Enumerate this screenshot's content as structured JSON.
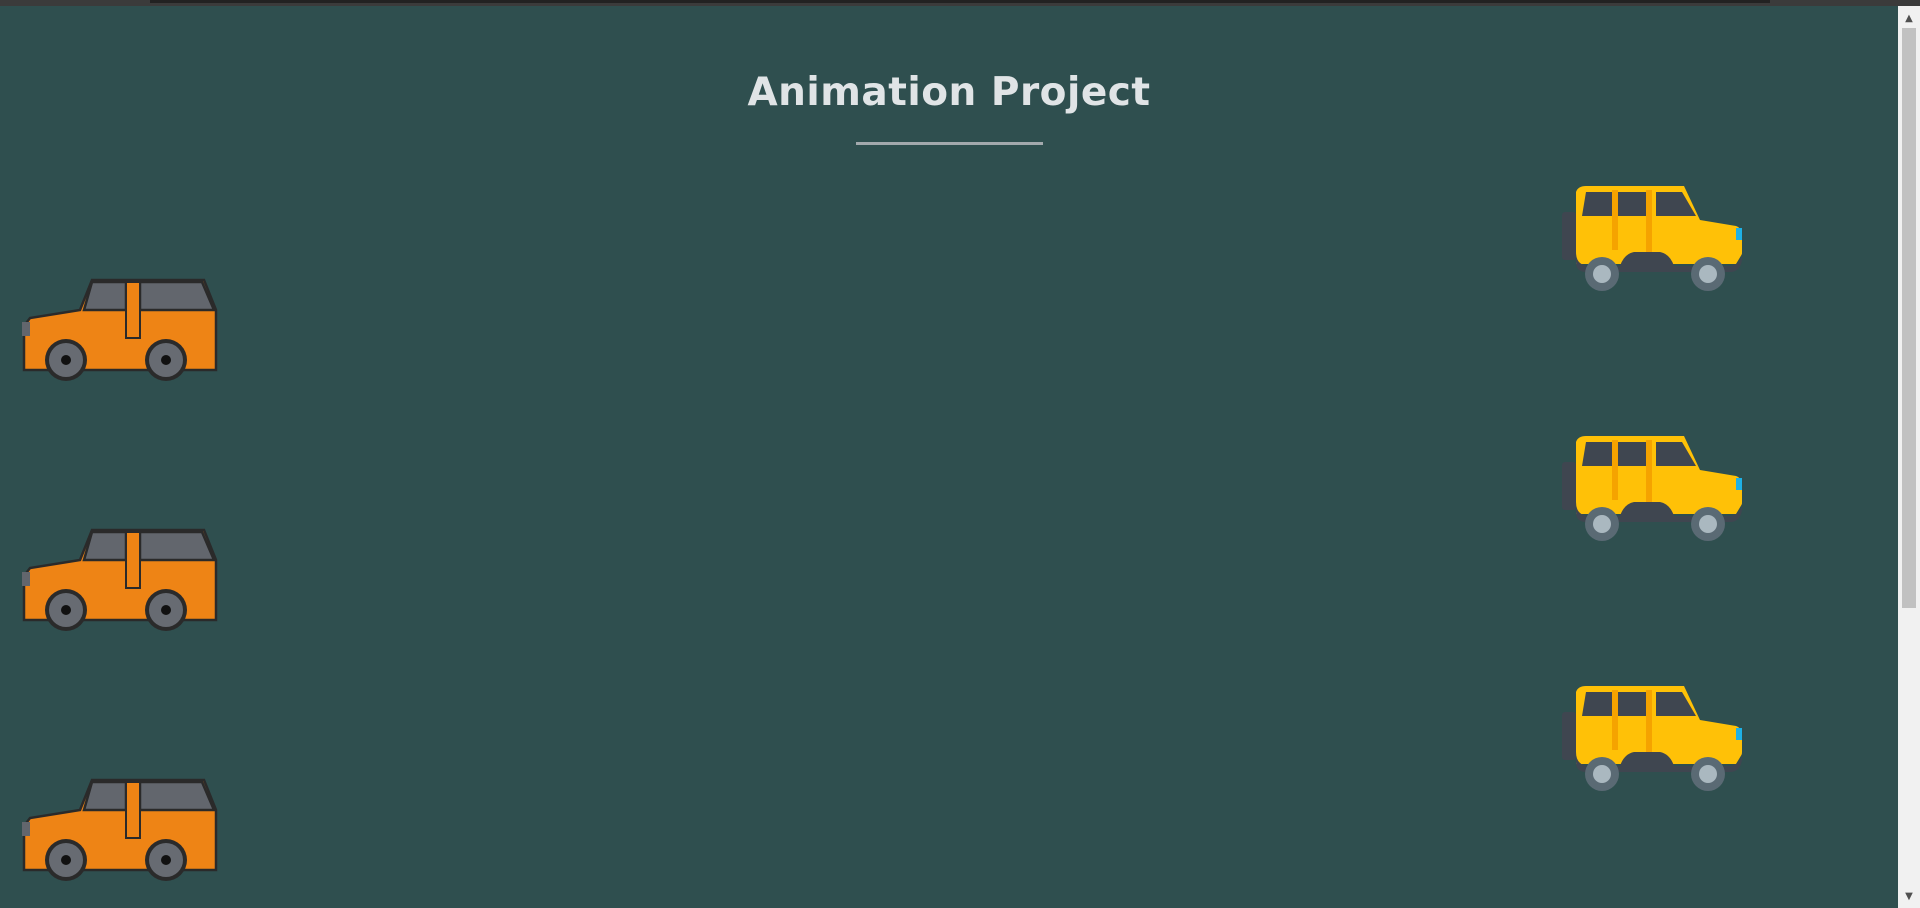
{
  "header": {
    "title": "Animation Project"
  },
  "cars": {
    "left_column": [
      {
        "name": "orange-car-1",
        "color": "#ee8415"
      },
      {
        "name": "orange-car-2",
        "color": "#ee8415"
      },
      {
        "name": "orange-car-3",
        "color": "#ee8415"
      }
    ],
    "right_column": [
      {
        "name": "yellow-jeep-1",
        "color": "#ffc107"
      },
      {
        "name": "yellow-jeep-2",
        "color": "#ffc107"
      },
      {
        "name": "yellow-jeep-3",
        "color": "#ffc107"
      }
    ]
  },
  "colors": {
    "background": "#2f4f4f",
    "title": "#e0e4e6",
    "underline": "#a3a9ad",
    "orange_body": "#ee8415",
    "yellow_body": "#ffc107",
    "window": "#62666d"
  },
  "icons": {
    "scroll_up": "▲",
    "scroll_down": "▼"
  }
}
